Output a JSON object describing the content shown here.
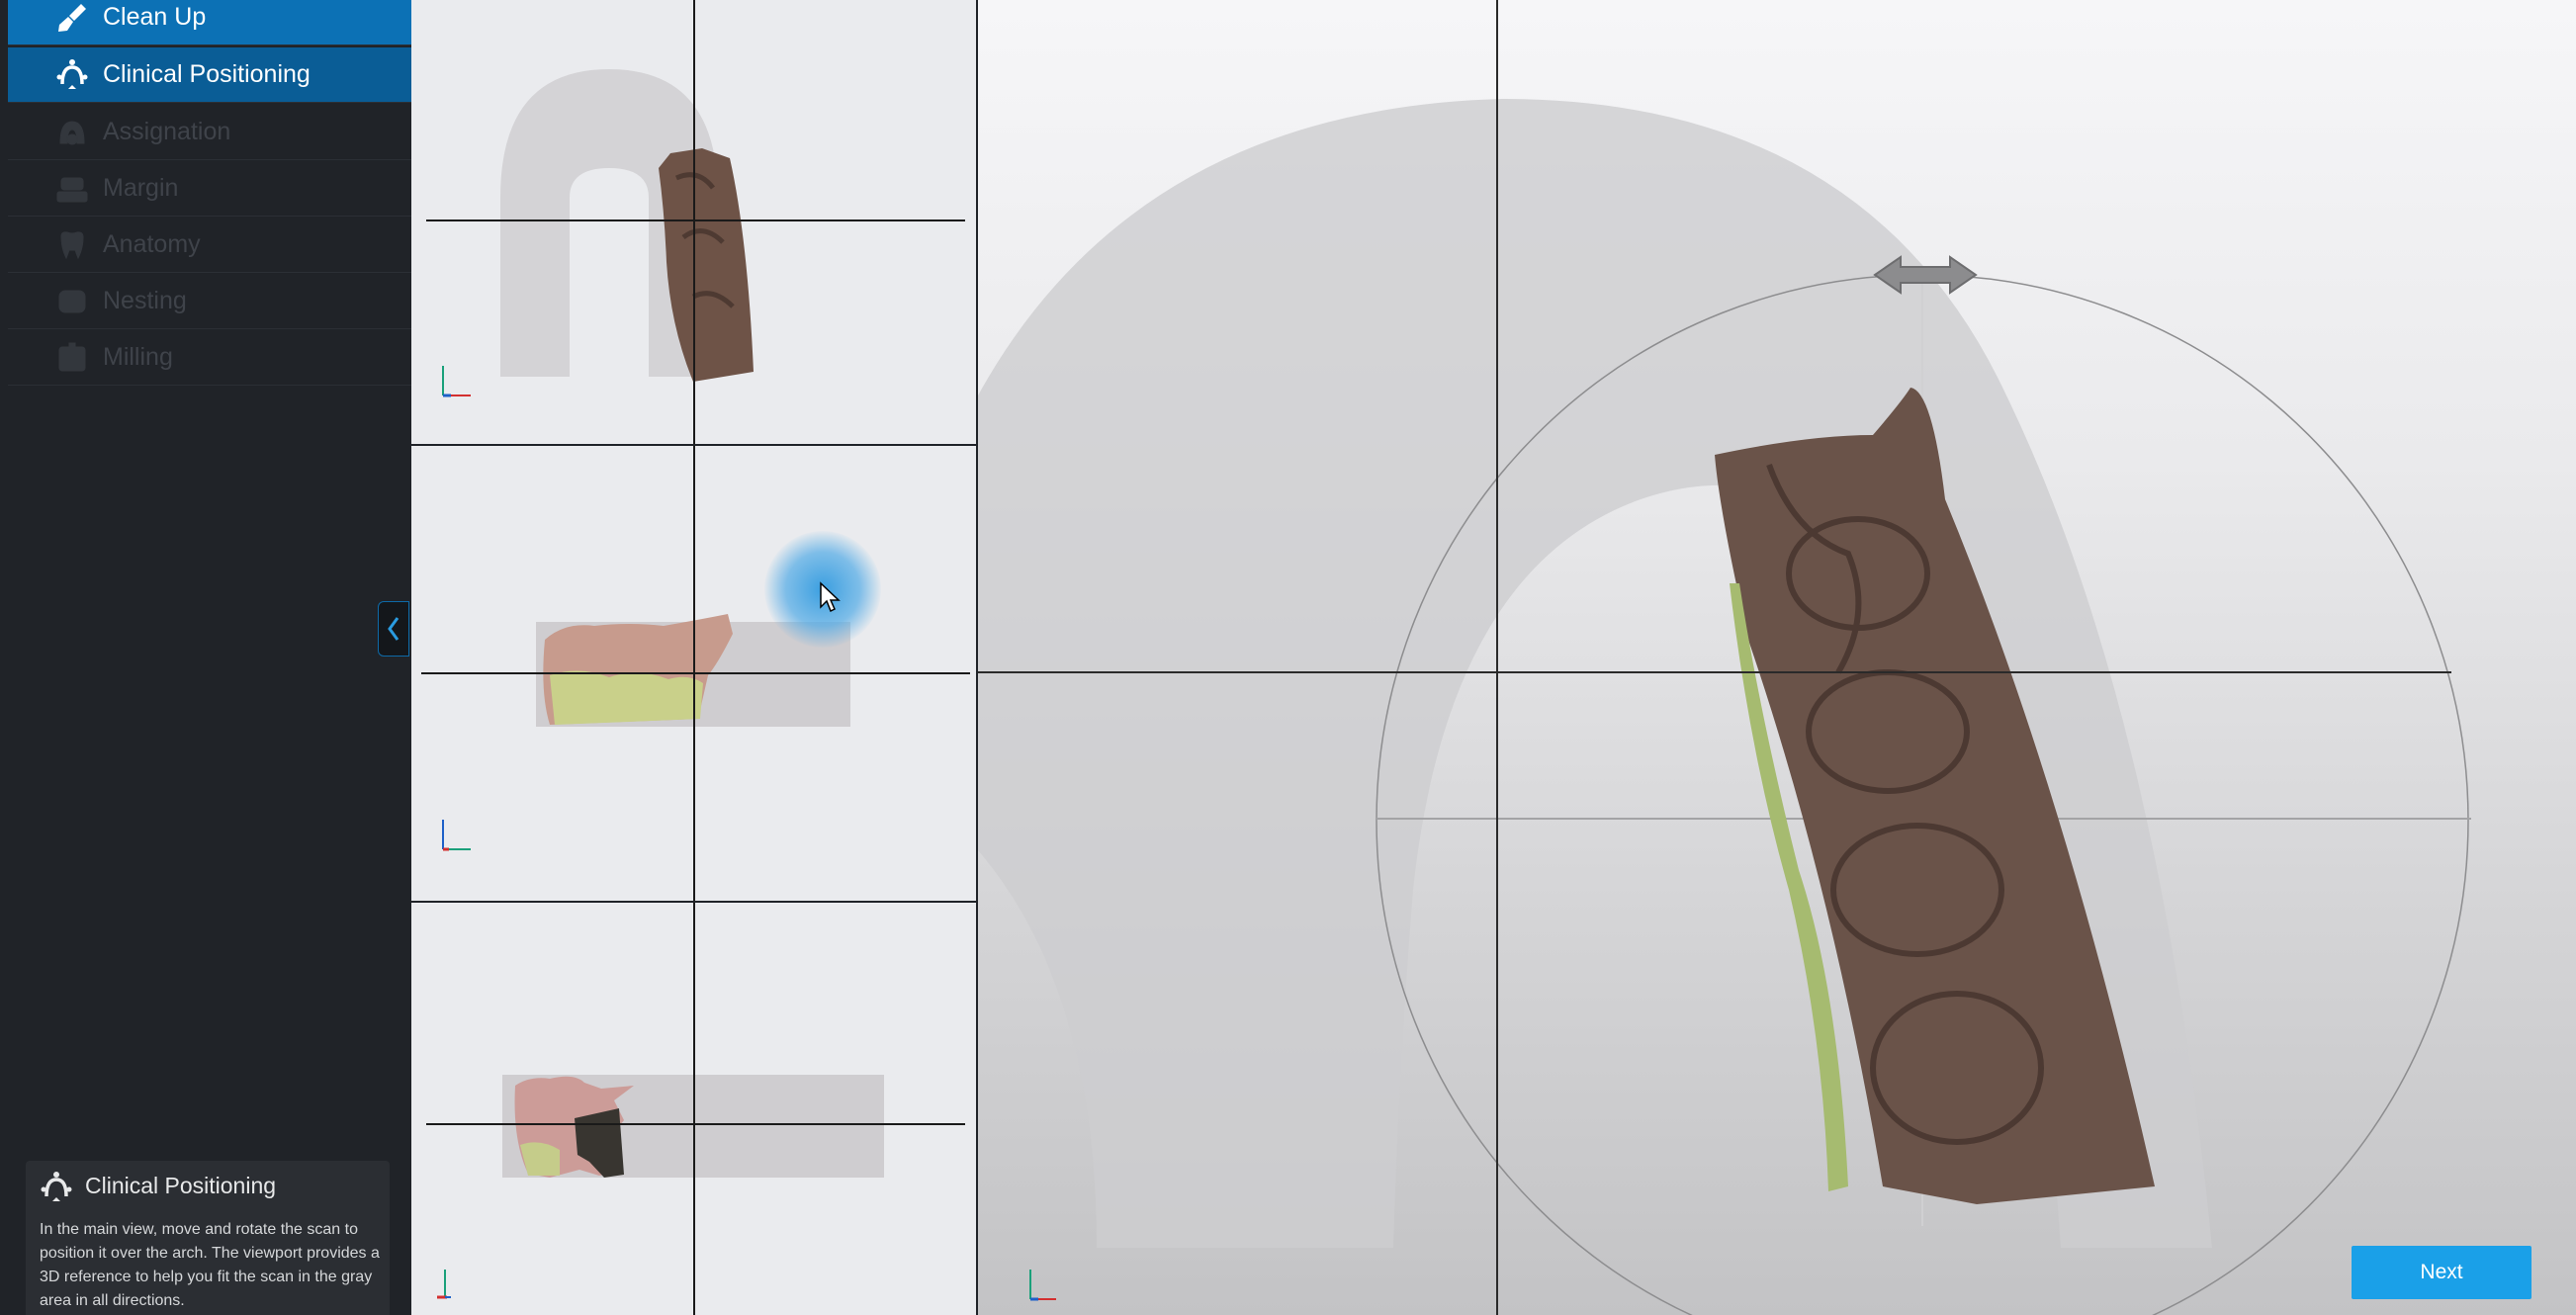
{
  "sidebar": {
    "steps": [
      {
        "label": "Clean Up",
        "state": "done",
        "icon": "brush-icon"
      },
      {
        "label": "Clinical Positioning",
        "state": "active",
        "icon": "positioning-icon"
      },
      {
        "label": "Assignation",
        "state": "disabled",
        "icon": "assignation-icon"
      },
      {
        "label": "Margin",
        "state": "disabled",
        "icon": "margin-icon"
      },
      {
        "label": "Anatomy",
        "state": "disabled",
        "icon": "tooth-icon"
      },
      {
        "label": "Nesting",
        "state": "disabled",
        "icon": "nesting-icon"
      },
      {
        "label": "Milling",
        "state": "disabled",
        "icon": "milling-icon"
      }
    ],
    "collapse_icon": "chevron-left-icon"
  },
  "help": {
    "title": "Clinical Positioning",
    "icon": "positioning-icon",
    "text": "In the main view, move and rotate the scan to position it over the arch. The viewport provides a 3D reference to help you fit the scan in the gray area in all directions."
  },
  "actions": {
    "next_label": "Next"
  },
  "colors": {
    "accent": "#1aa0e8",
    "step_done": "#0c71b5",
    "step_active": "#0a5d96",
    "sidebar_bg": "#202328"
  }
}
